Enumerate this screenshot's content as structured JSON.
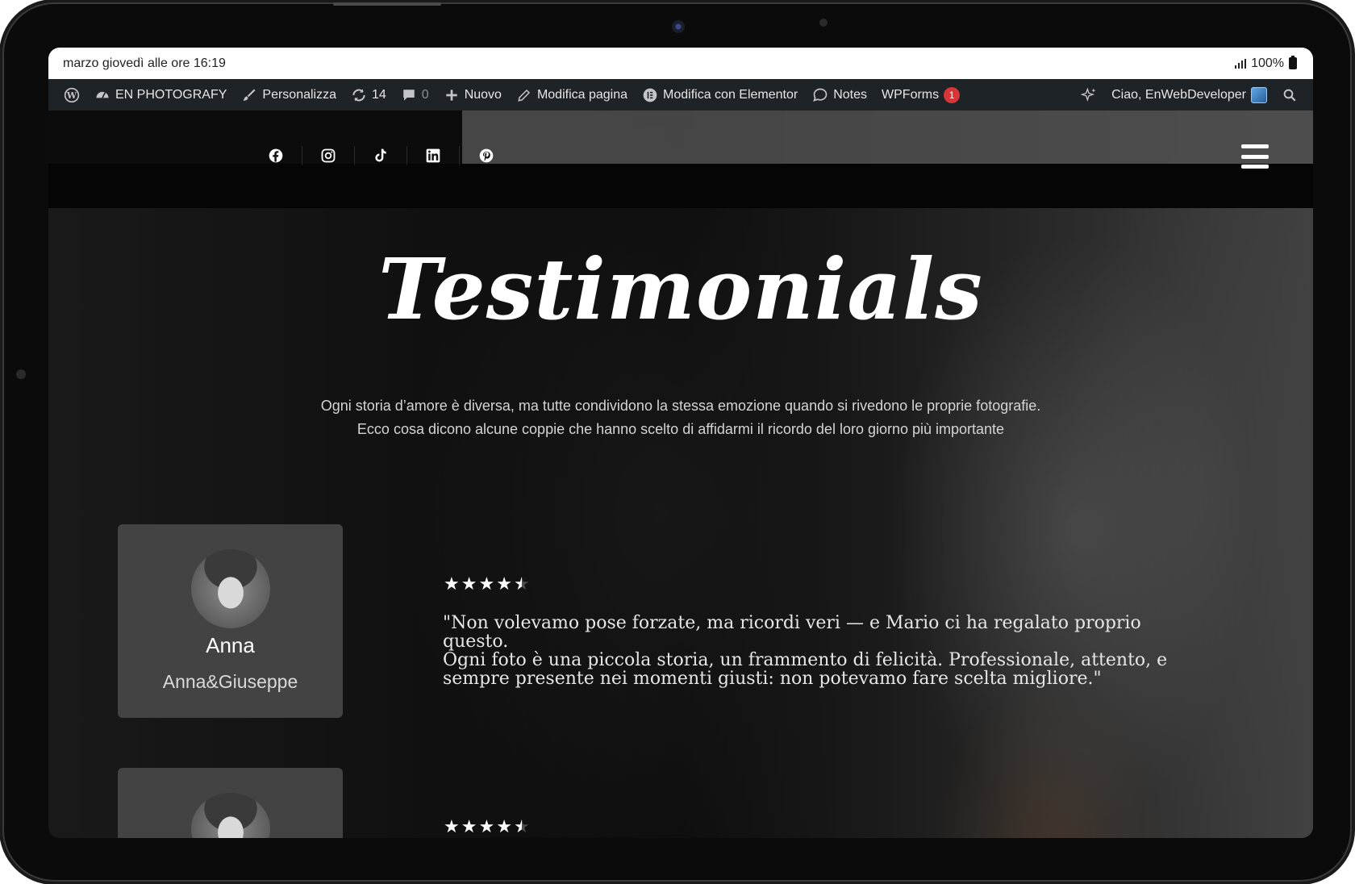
{
  "status_bar": {
    "datetime": "marzo giovedì alle ore 16:19",
    "battery": "100%"
  },
  "admin_bar": {
    "site_name": "EN PHOTOGRAFY",
    "customize": "Personalizza",
    "updates_count": "14",
    "comments_count": "0",
    "new": "Nuovo",
    "edit_page": "Modifica pagina",
    "edit_elementor": "Modifica con Elementor",
    "notes": "Notes",
    "wpforms": "WPForms",
    "wpforms_badge": "1",
    "greeting": "Ciao, EnWebDeveloper"
  },
  "social_icons": [
    "facebook-icon",
    "instagram-icon",
    "tiktok-icon",
    "linkedin-icon",
    "pinterest-icon"
  ],
  "hero": {
    "title": "Testimonials",
    "intro_line1": "Ogni storia d’amore è diversa, ma tutte condividono la stessa emozione quando si rivedono le proprie fotografie.",
    "intro_line2": "Ecco cosa dicono alcune coppie che hanno scelto di affidarmi il ricordo del loro giorno più importante"
  },
  "testimonials": [
    {
      "name": "Anna",
      "couple": "Anna&Giuseppe",
      "rating": 4.5,
      "quote_line1": "\"Non volevamo pose forzate, ma ricordi veri — e Mario ci ha regalato proprio questo.",
      "quote_line2": "Ogni foto è una piccola storia, un frammento di felicità. Professionale, attento, e",
      "quote_line3": "sempre presente nei momenti giusti: non potevamo fare scelta migliore.\""
    },
    {
      "rating": 4.5
    }
  ],
  "colors": {
    "admin_bar_bg": "#1d2327",
    "badge": "#d63638",
    "card_bg": "#484848"
  }
}
